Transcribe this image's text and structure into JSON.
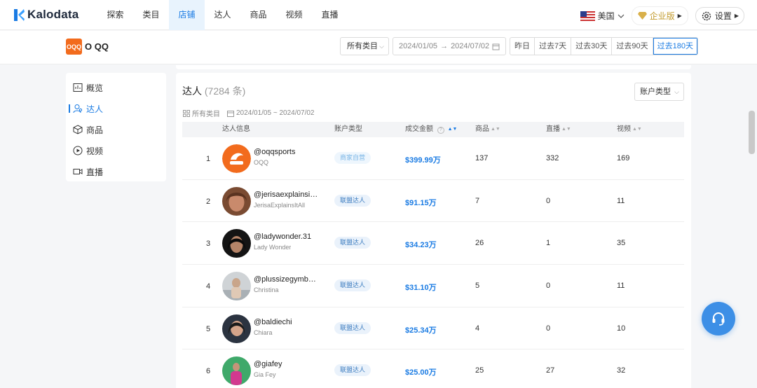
{
  "brand": {
    "name": "Kalodata"
  },
  "nav": {
    "items": [
      "探索",
      "类目",
      "店铺",
      "达人",
      "商品",
      "视频",
      "直播"
    ],
    "active_index": 2
  },
  "header_right": {
    "language": "美国",
    "enterprise": "企业版",
    "settings": "设置"
  },
  "shop": {
    "logo_text": "OQQ",
    "name": "O QQ"
  },
  "filters": {
    "category": "所有类目",
    "date_start": "2024/01/05",
    "date_sep": "→",
    "date_end": "2024/07/02",
    "ranges": [
      "昨日",
      "过去7天",
      "过去30天",
      "过去90天",
      "过去180天"
    ],
    "active_range": "过去180天"
  },
  "sidebar": {
    "items": [
      {
        "label": "概览",
        "icon": "chart-icon"
      },
      {
        "label": "达人",
        "icon": "user-icon"
      },
      {
        "label": "商品",
        "icon": "box-icon"
      },
      {
        "label": "视频",
        "icon": "play-icon"
      },
      {
        "label": "直播",
        "icon": "camera-icon"
      }
    ],
    "active_index": 1
  },
  "creators": {
    "title": "达人",
    "count": "(7284 条)",
    "account_type_filter": "账户类型",
    "applied_category": "所有类目",
    "applied_dates": "2024/01/05 ~ 2024/07/02",
    "columns": {
      "info": "达人信息",
      "account_type": "账户类型",
      "gmv": "成交金额",
      "products": "商品",
      "live": "直播",
      "videos": "视频"
    },
    "rows": [
      {
        "rank": "1",
        "handle": "@oqqsports",
        "name": "OQQ",
        "type": "商家自营",
        "gmv": "$399.99万",
        "products": "137",
        "live": "332",
        "videos": "169"
      },
      {
        "rank": "2",
        "handle": "@jerisaexplainsit…",
        "name": "JerisaExplainsItAll",
        "type": "联盟达人",
        "gmv": "$91.15万",
        "products": "7",
        "live": "0",
        "videos": "11"
      },
      {
        "rank": "3",
        "handle": "@ladywonder.31",
        "name": "Lady Wonder",
        "type": "联盟达人",
        "gmv": "$34.23万",
        "products": "26",
        "live": "1",
        "videos": "35"
      },
      {
        "rank": "4",
        "handle": "@plussizegymbe…",
        "name": "Christina",
        "type": "联盟达人",
        "gmv": "$31.10万",
        "products": "5",
        "live": "0",
        "videos": "11"
      },
      {
        "rank": "5",
        "handle": "@baldiechi",
        "name": "Chiara",
        "type": "联盟达人",
        "gmv": "$25.34万",
        "products": "4",
        "live": "0",
        "videos": "10"
      },
      {
        "rank": "6",
        "handle": "@giafey",
        "name": "Gia Fey",
        "type": "联盟达人",
        "gmv": "$25.00万",
        "products": "25",
        "live": "27",
        "videos": "32"
      }
    ]
  },
  "colors": {
    "accent": "#1a7be3",
    "shop_orange": "#f26b1d",
    "fab": "#3d8fe6",
    "enterprise_gold": "#c29a2b"
  }
}
